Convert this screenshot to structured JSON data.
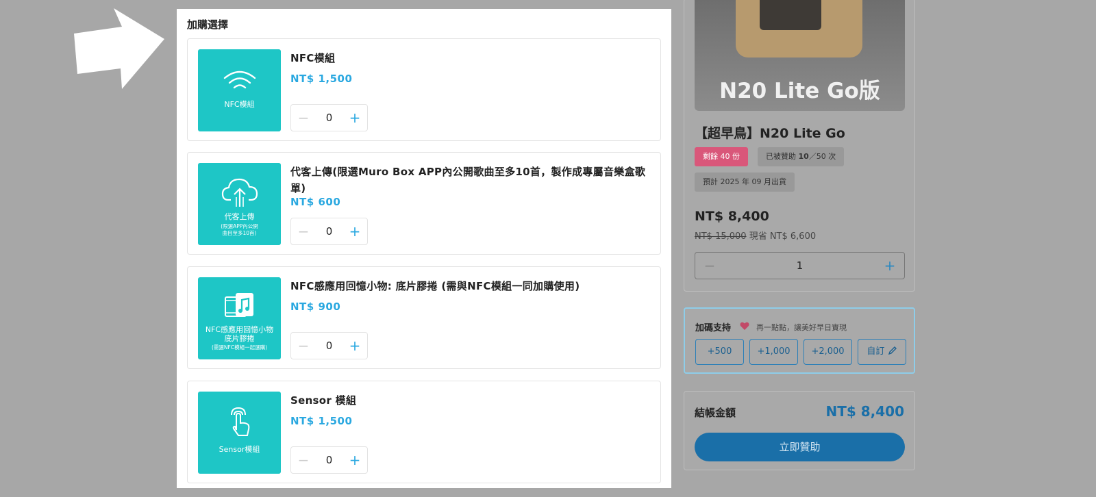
{
  "addon_section": {
    "title": "加購選擇",
    "items": [
      {
        "name": "NFC模組",
        "price": "NT$ 1,500",
        "qty": "0",
        "thumb_title": "NFC模組",
        "thumb_note": "",
        "icon": "wifi-icon"
      },
      {
        "name": "代客上傳(限選Muro Box APP內公開歌曲至多10首，製作成專屬音樂盒歌單)",
        "price": "NT$ 600",
        "qty": "0",
        "thumb_title": "代客上傳",
        "thumb_note": "(限選APP內公開\n曲目至多10首)",
        "icon": "cloud-upload-icon"
      },
      {
        "name": "NFC感應用回憶小物: 底片膠捲 (需與NFC模組一同加購使用)",
        "price": "NT$ 900",
        "qty": "0",
        "thumb_title": "NFC感應用回憶小物\n底片膠捲",
        "thumb_note": "(需選NFC模組一起選購)",
        "icon": "film-music-icon"
      },
      {
        "name": "Sensor 模組",
        "price": "NT$ 1,500",
        "qty": "0",
        "thumb_title": "Sensor模組",
        "thumb_note": "",
        "icon": "touch-hand-icon"
      }
    ],
    "minus": "−",
    "plus": "+"
  },
  "product": {
    "image_text": "N20 Lite Go版",
    "title": "【超早鳥】N20 Lite Go",
    "badge_remaining": "剩餘 40 份",
    "badge_sponsored_prefix": "已被贊助 ",
    "badge_sponsored_count": "10",
    "badge_sponsored_suffix": "／50 次",
    "badge_ship": "預計 2025 年 09 月出貨",
    "price": "NT$ 8,400",
    "old_price": "NT$ 15,000",
    "saving": "現省 NT$ 6,600",
    "qty": "1",
    "minus": "−",
    "plus": "+"
  },
  "support": {
    "title": "加碼支持",
    "hint": "再一點點，讓美好早日實現",
    "amounts": [
      "+500",
      "+1,000",
      "+2,000"
    ],
    "custom_label": "自訂"
  },
  "checkout": {
    "label": "結帳金額",
    "total": "NT$ 8,400",
    "button": "立即贊助"
  },
  "colors": {
    "accent": "#2aa8e0",
    "thumb_bg": "#1ec6c6",
    "badge_red": "#d9577a",
    "checkout_blue": "#1a6fa8"
  }
}
